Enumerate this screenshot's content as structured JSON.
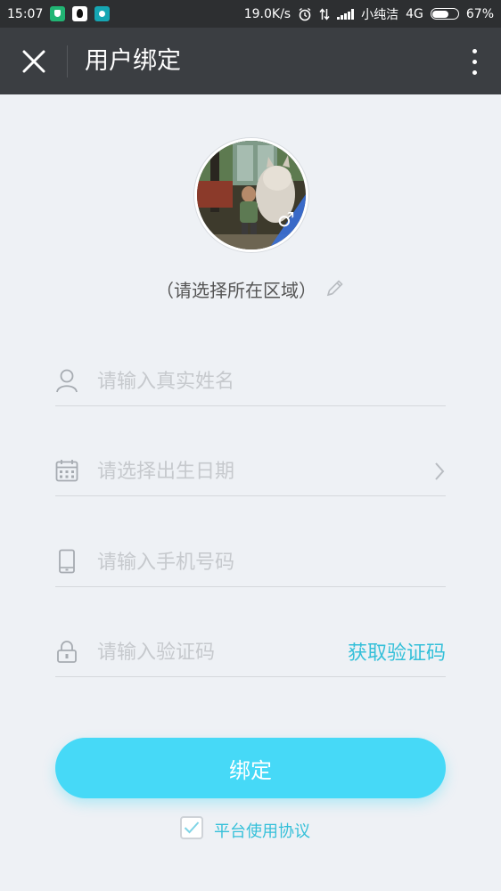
{
  "status_bar": {
    "time": "15:07",
    "net_speed": "19.0K/s",
    "carrier": "小纯洁",
    "network": "4G",
    "battery": "67%",
    "battery_level": 0.67
  },
  "header": {
    "title": "用户绑定"
  },
  "profile": {
    "gender_symbol": "♂",
    "region_text": "（请选择所在区域）"
  },
  "form": {
    "name_placeholder": "请输入真实姓名",
    "birthdate_placeholder": "请选择出生日期",
    "phone_placeholder": "请输入手机号码",
    "code_placeholder": "请输入验证码",
    "get_code_label": "获取验证码"
  },
  "bind_button_label": "绑定",
  "agreement": {
    "checked": true,
    "label": "平台使用协议"
  },
  "colors": {
    "accent": "#46d9f7",
    "link": "#35c0d9",
    "header_bg": "#3b3e42",
    "page_bg": "#eef1f5"
  }
}
